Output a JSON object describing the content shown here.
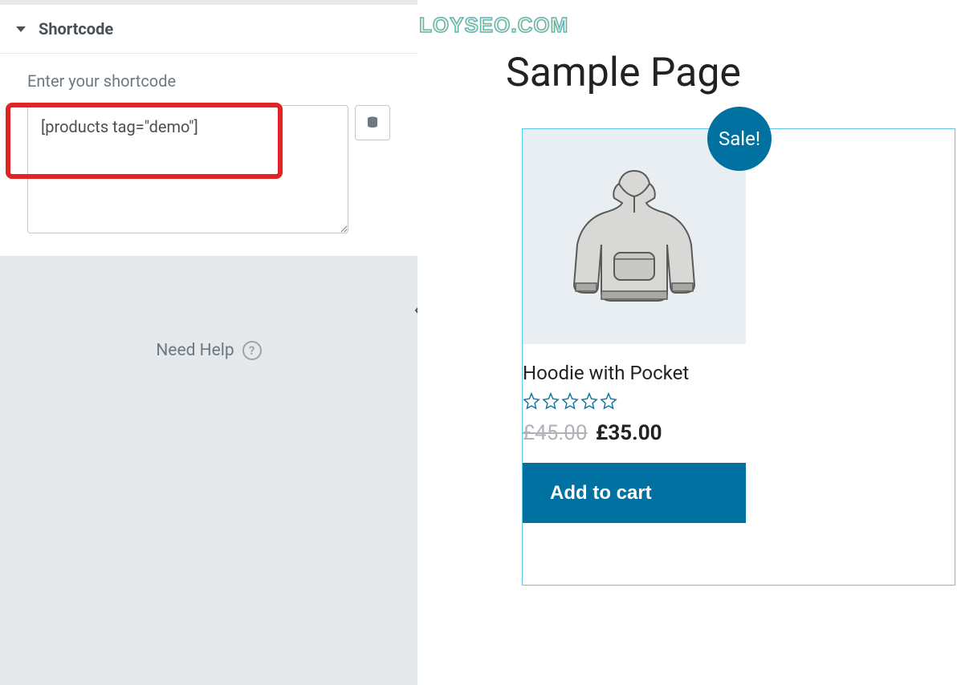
{
  "watermark": "LOYSEO.COM",
  "sidebar": {
    "section_title": "Shortcode",
    "field_label": "Enter your shortcode",
    "shortcode_value": "[products tag=\"demo\"]",
    "need_help": "Need Help",
    "help_symbol": "?"
  },
  "preview": {
    "page_title": "Sample Page",
    "product": {
      "sale_label": "Sale!",
      "name": "Hoodie with Pocket",
      "old_price": "£45.00",
      "new_price": "£35.00",
      "button_label": "Add to cart",
      "rating": 0
    }
  }
}
